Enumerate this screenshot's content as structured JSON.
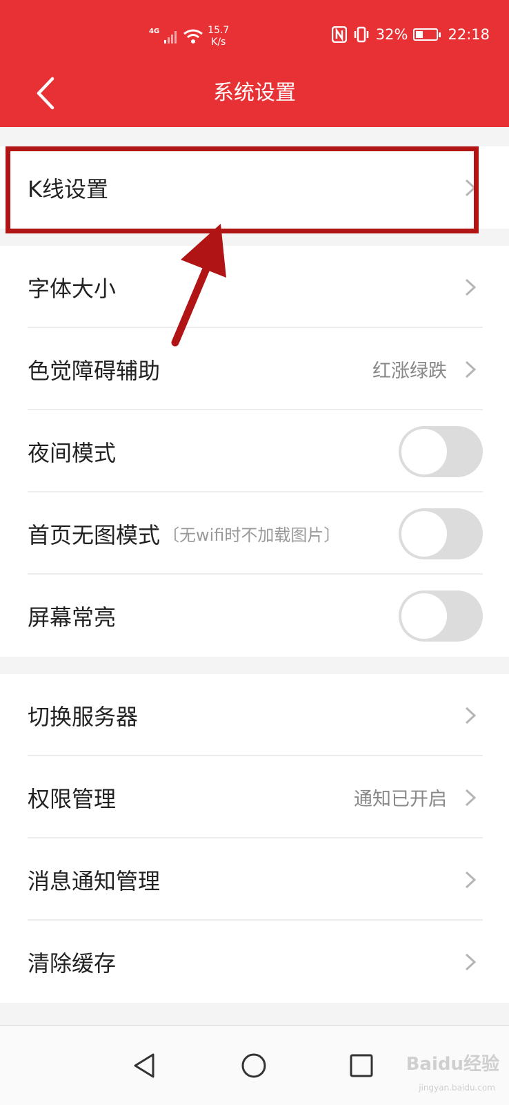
{
  "status_bar": {
    "network": "4G",
    "net_speed_value": "15.7",
    "net_speed_unit": "K/s",
    "battery_percent": "32%",
    "time": "22:18"
  },
  "header": {
    "title": "系统设置",
    "color": "#e83134"
  },
  "groups": {
    "kline": {
      "label": "K线设置"
    },
    "display": {
      "font_size": {
        "label": "字体大小"
      },
      "color_blind": {
        "label": "色觉障碍辅助",
        "value": "红涨绿跌"
      },
      "night_mode": {
        "label": "夜间模式",
        "on": false
      },
      "no_image": {
        "label": "首页无图模式",
        "hint": "〔无wifi时不加载图片〕",
        "on": false
      },
      "screen_on": {
        "label": "屏幕常亮",
        "on": false
      }
    },
    "system": {
      "server": {
        "label": "切换服务器"
      },
      "permission": {
        "label": "权限管理",
        "value": "通知已开启"
      },
      "notification": {
        "label": "消息通知管理"
      },
      "cache": {
        "label": "清除缓存"
      }
    }
  },
  "annotation": {
    "color": "#b01415"
  },
  "watermark": {
    "text": "Baidu经验",
    "sub": "jingyan.baidu.com"
  }
}
